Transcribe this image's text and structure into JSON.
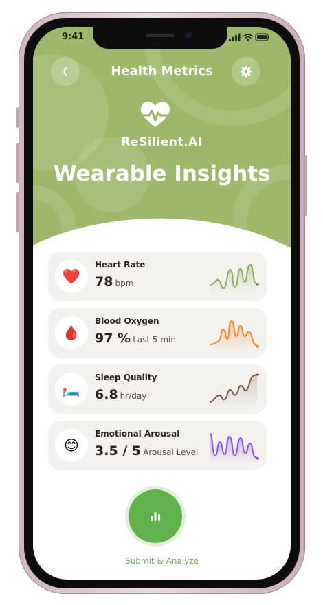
{
  "status_bar": {
    "time": "9:41"
  },
  "header": {
    "title": "Health Metrics",
    "back_icon": "chevron-left-icon",
    "settings_icon": "gear-icon"
  },
  "brand": {
    "name": "ReSilient.AI",
    "logo_icon": "heart-pulse-icon"
  },
  "hero": {
    "title": "Wearable Insights"
  },
  "colors": {
    "hero_green": "#9db86b",
    "button_green": "#5fb34a",
    "card_bg": "#f4f2ef",
    "heart_line": "#8dae5c",
    "oxygen_line": "#f08a2e",
    "sleep_line": "#7a5a44",
    "arousal_line": "#8b56e6"
  },
  "metrics": [
    {
      "label": "Heart Rate",
      "value": "78",
      "unit": "bpm",
      "icon": "red-heart-emoji"
    },
    {
      "label": "Blood Oxygen",
      "value": "97 %",
      "unit": "Last 5 min",
      "icon": "blood-drop-emoji"
    },
    {
      "label": "Sleep Quality",
      "value": "6.8",
      "unit": "hr/day",
      "icon": "bed-emoji"
    },
    {
      "label": "Emotional Arousal",
      "value": "3.5 / 5",
      "unit": "Arousal Level",
      "icon": "smiling-face-emoji"
    }
  ],
  "action": {
    "label": "Submit & Analyze",
    "icon": "bar-chart-icon"
  }
}
